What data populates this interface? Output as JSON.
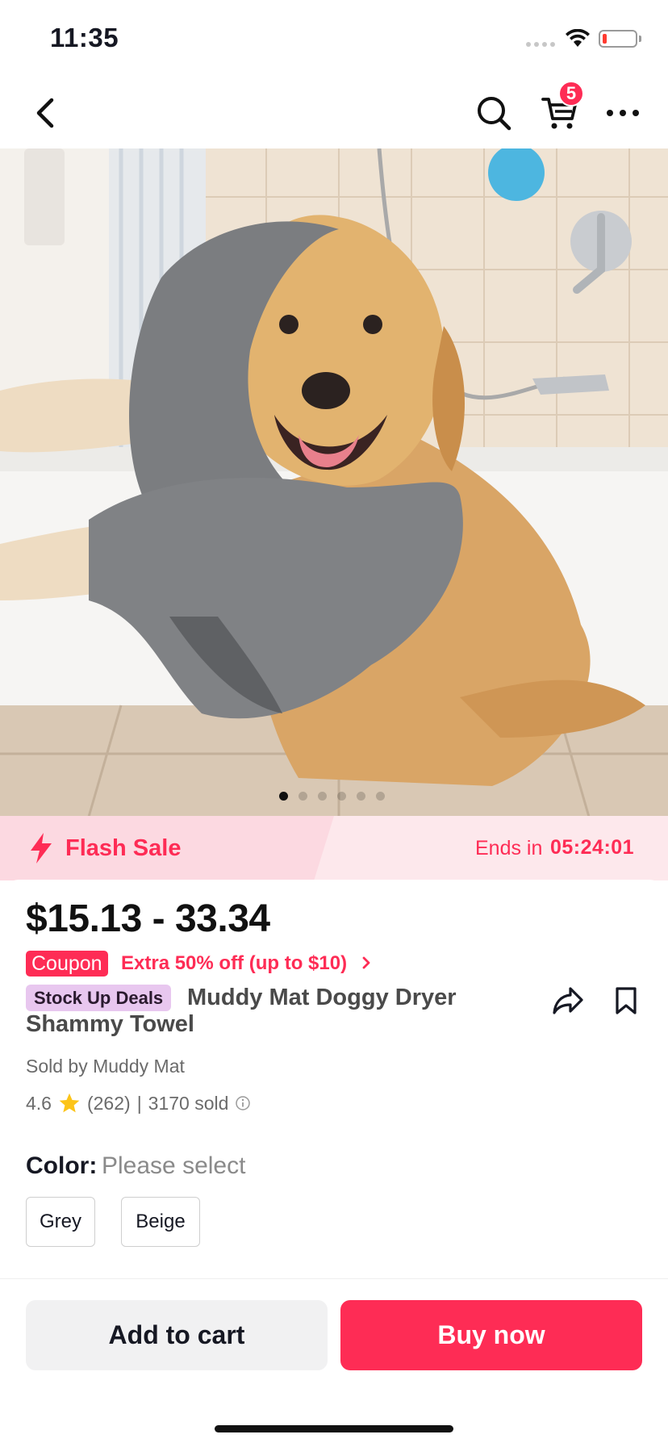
{
  "status_bar": {
    "time": "11:35"
  },
  "header": {
    "back_icon": "chevron-left-icon",
    "search_icon": "search-icon",
    "cart_icon": "cart-icon",
    "cart_count": "5",
    "more_icon": "more-horizontal-icon"
  },
  "gallery": {
    "total_images": 6,
    "active_index": 0
  },
  "flash_sale": {
    "title": "Flash Sale",
    "ends_label": "Ends in",
    "timer": "05:24:01"
  },
  "product": {
    "price": "$15.13 - 33.34",
    "coupon_tag": "Coupon",
    "coupon_text": "Extra 50% off (up to $10)",
    "deal_tag": "Stock Up Deals",
    "title_line1": "Muddy Mat Doggy Dryer",
    "title_line2": "Shammy Towel",
    "sold_by": "Sold by Muddy Mat",
    "rating": "4.6",
    "reviews": "(262)",
    "separator": "|",
    "sold_count": "3170 sold"
  },
  "variants": {
    "label": "Color:",
    "placeholder": "Please select",
    "options": [
      "Grey",
      "Beige"
    ]
  },
  "actions": {
    "add_to_cart": "Add to cart",
    "buy_now": "Buy now"
  },
  "colors": {
    "accent": "#fe2c55",
    "flash_bg": "#fde8ec",
    "deal_tag_bg": "#e8c7ef",
    "star": "#fcc419"
  }
}
